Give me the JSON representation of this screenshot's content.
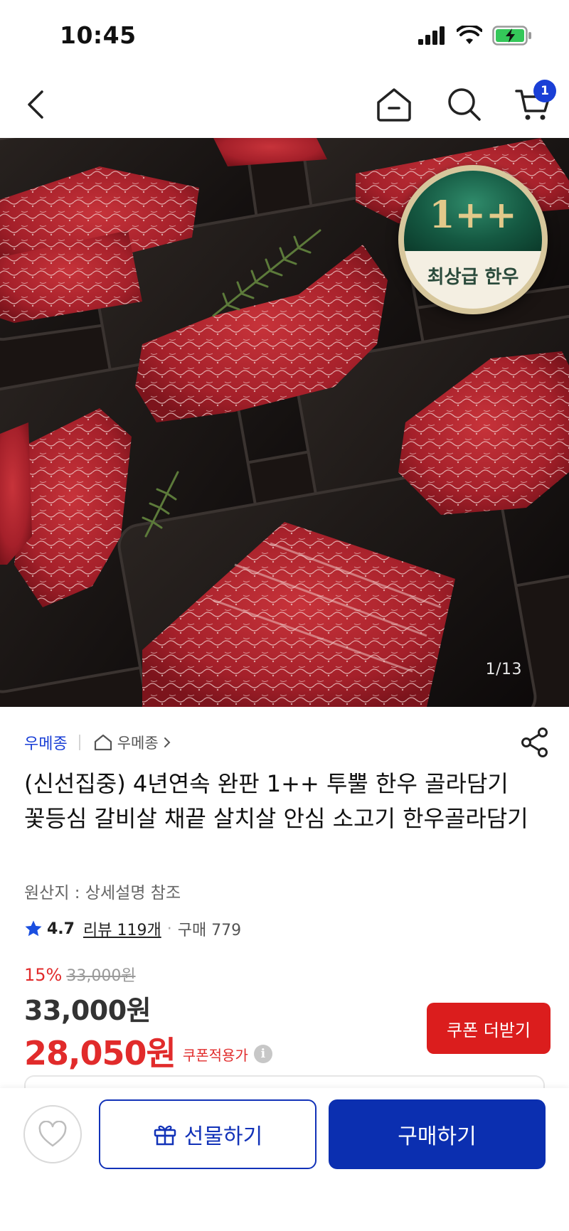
{
  "status_bar": {
    "time": "10:45"
  },
  "nav": {
    "cart_count": "1"
  },
  "hero": {
    "counter": "1/13",
    "badge_grade": "1++",
    "badge_label": "최상급 한우"
  },
  "product": {
    "brand": "우메종",
    "store": "우메종",
    "title": "(신선집중) 4년연속 완판 1++ 투뿔 한우 골라담기 꽃등심 갈비살 채끝 살치살 안심 소고기 한우골라담기",
    "origin": "원산지 : 상세설명 참조",
    "rating": "4.7",
    "reviews": "리뷰 119개",
    "purchases": "구매 779"
  },
  "price": {
    "discount_rate": "15%",
    "original": "33,000원",
    "sale": "33,000원",
    "coupon_price": "28,050원",
    "coupon_label": "쿠폰적용가",
    "coupon_button": "쿠폰 더받기"
  },
  "actions": {
    "gift": "선물하기",
    "buy": "구매하기"
  },
  "colors": {
    "accent_blue": "#0b2fb0",
    "sale_red": "#e12b2b"
  }
}
